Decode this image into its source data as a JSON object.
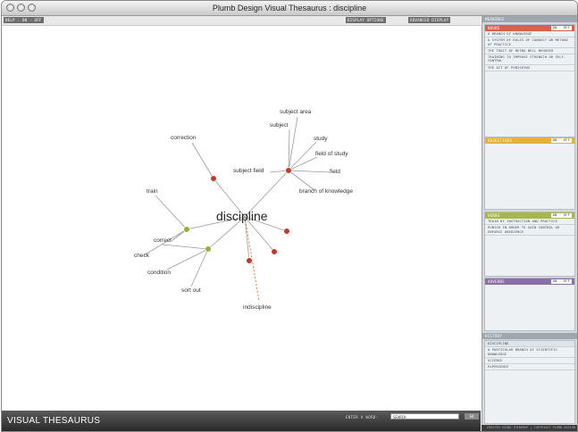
{
  "window": {
    "title": "Plumb Design Visual Thesaurus : discipline"
  },
  "toolbar": {
    "help_label": "HELP : ON · OFF",
    "display_options_label": "DISPLAY OPTIONS",
    "advanced_label": "ADVANCED DISPLAY"
  },
  "graph": {
    "center_word": "discipline",
    "words": {
      "subject_area": "subject area",
      "subject": "subject",
      "study": "study",
      "field_of_study": "field of study",
      "field": "field",
      "branch_of_knowledge": "branch of knowledge",
      "subject_field": "subject field",
      "correction": "correction",
      "train": "train",
      "correct": "correct",
      "check": "check",
      "condition": "condition",
      "sort_out": "sort out",
      "indiscipline": "indiscipline"
    },
    "colors": {
      "noun_node": "#c0392b",
      "verb_node": "#9aac3a",
      "line": "#9a9a9a",
      "antonym_line": "#e07a3c"
    }
  },
  "footer": {
    "logo": "VISUAL THESAURUS",
    "enter_label": "ENTER A WORD:",
    "input_value": "SEARCH",
    "go_label": "GO",
    "copyright": "CREATED USING THINKMAP | COPYRIGHT PLUMB DESIGN INC"
  },
  "sidebar": {
    "meanings_title": "MEANINGS",
    "noun_panel": {
      "label": "NOUNS",
      "toggle": "ON · OFF",
      "color": "#d9604a",
      "definitions": [
        "A BRANCH OF KNOWLEDGE",
        "A SYSTEM OF RULES OF CONDUCT OR METHOD OF PRACTICE",
        "THE TRAIT OF BEING WELL BEHAVED",
        "TRAINING TO IMPROVE STRENGTH OR SELF-CONTROL",
        "THE ACT OF PUNISHING"
      ]
    },
    "adjective_panel": {
      "label": "ADJECTIVES",
      "toggle": "ON · OFF",
      "color": "#e2b23a",
      "definitions": []
    },
    "verb_panel": {
      "label": "VERBS",
      "toggle": "ON · OFF",
      "color": "#a7b84a",
      "definitions": [
        "TRAIN BY INSTRUCTION AND PRACTICE",
        "PUNISH IN ORDER TO GAIN CONTROL OR ENFORCE OBEDIENCE"
      ]
    },
    "adverb_panel": {
      "label": "ADVERBS",
      "toggle": "ON · OFF",
      "color": "#8a6fa6",
      "definitions": []
    },
    "history_title": "HISTORY",
    "history": [
      "DISCIPLINE",
      "A PARTICULAR BRANCH OF SCIENTIFIC KNOWLEDGE",
      "SCIENCE",
      "EXPERIENCE"
    ]
  }
}
